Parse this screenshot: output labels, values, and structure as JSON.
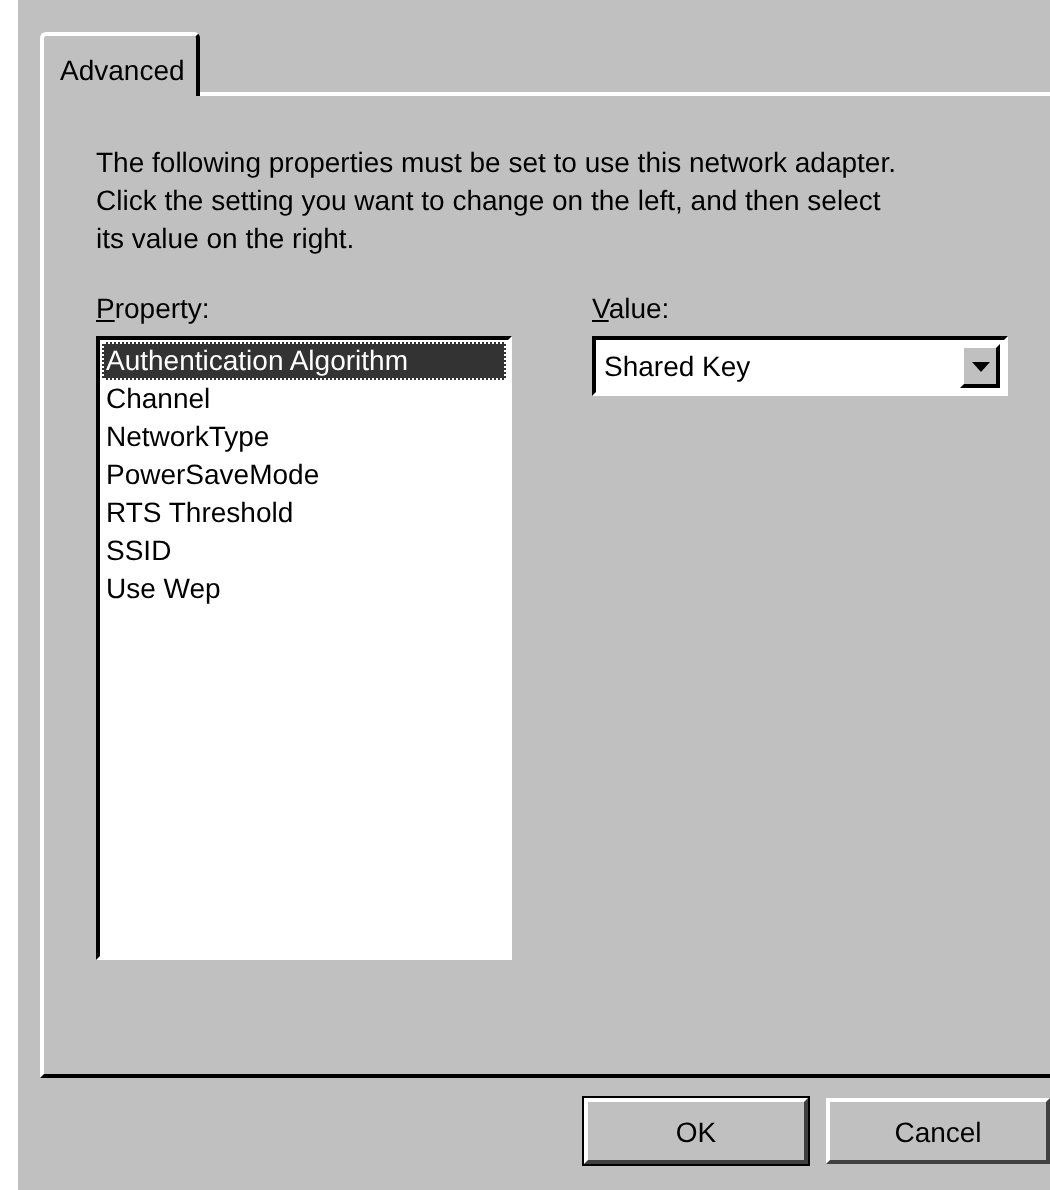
{
  "tabs": [
    {
      "label": "Advanced",
      "selected": true
    }
  ],
  "description": "The following properties must be set to use this network adapter. Click the setting you want to change on the left, and then select its value on the right.",
  "property": {
    "label": "Property:",
    "items": [
      {
        "label": "Authentication Algorithm",
        "selected": true
      },
      {
        "label": "Channel",
        "selected": false
      },
      {
        "label": "NetworkType",
        "selected": false
      },
      {
        "label": "PowerSaveMode",
        "selected": false
      },
      {
        "label": "RTS Threshold",
        "selected": false
      },
      {
        "label": "SSID",
        "selected": false
      },
      {
        "label": "Use Wep",
        "selected": false
      }
    ]
  },
  "value": {
    "label": "Value:",
    "selected_value": "Shared Key"
  },
  "buttons": [
    {
      "label": "OK",
      "default": true
    },
    {
      "label": "Cancel",
      "default": false
    }
  ]
}
